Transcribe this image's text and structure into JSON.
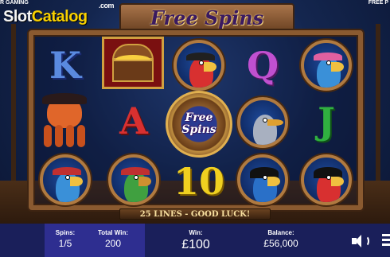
{
  "header": {
    "provider_fragment": "R GAMING",
    "brand_slot": "Slot",
    "brand_catalog": "Catalog",
    "brand_com": ".com",
    "title": "Free Spins",
    "right_fragment": "FREE P"
  },
  "reels": [
    {
      "col": 1,
      "symbols": [
        "K",
        "pirate-octopus",
        "blue-parrot-pirate"
      ]
    },
    {
      "col": 2,
      "symbols": [
        "treasure-chest",
        "A",
        "green-parrot-pirate"
      ]
    },
    {
      "col": 3,
      "symbols": [
        "red-parrot-pirate",
        "free-spins-scatter",
        "10"
      ]
    },
    {
      "col": 4,
      "symbols": [
        "Q",
        "pelican",
        "blue-parrot-skull-hat"
      ]
    },
    {
      "col": 5,
      "symbols": [
        "bandana-parrot",
        "J",
        "red-parrot-skull-hat"
      ]
    }
  ],
  "letters": {
    "K": "K",
    "A": "A",
    "Q": "Q",
    "J": "J",
    "ten": "10"
  },
  "scatter": {
    "line1": "Free",
    "line2": "Spins"
  },
  "lines_message": "25 LINES - GOOD LUCK!",
  "bottom_bar": {
    "spins_label": "Spins:",
    "spins_value": "1/5",
    "total_win_label": "Total Win:",
    "total_win_value": "200",
    "win_label": "Win:",
    "win_value": "£100",
    "balance_label": "Balance:",
    "balance_value": "£56,000"
  },
  "icons": [
    "sound-icon",
    "menu-icon"
  ],
  "colors": {
    "bottom_bar": "#1a1f5a",
    "spins_box": "#2e2e90",
    "frame": "#8a5a30"
  }
}
